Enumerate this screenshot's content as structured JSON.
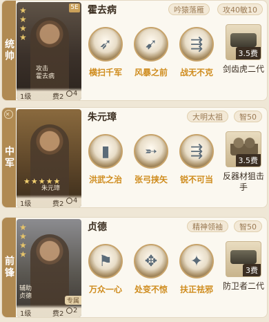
{
  "cards": [
    {
      "position": "统帅",
      "name": "霍去病",
      "tags": [
        "吟猿落雁",
        "攻40敏10"
      ],
      "portrait": {
        "role": "攻击",
        "name": "霍去病",
        "level": "1级",
        "cost": "费2",
        "range": "4",
        "stars": 4,
        "corner": "5E"
      },
      "skills": [
        {
          "icon": "arrow-volley-icon",
          "label": "横扫千军"
        },
        {
          "icon": "storm-arrows-icon",
          "label": "风暴之前"
        },
        {
          "icon": "spears-icon",
          "label": "战无不克"
        }
      ],
      "equipment": {
        "name": "剑齿虎二代",
        "cost": "3.5费",
        "type": "tank"
      }
    },
    {
      "position": "中军",
      "name": "朱元璋",
      "tags": [
        "大明太祖",
        "智50"
      ],
      "portrait": {
        "role": "",
        "name": "朱元璋",
        "level": "1级",
        "cost": "费2",
        "range": "4",
        "stars": 5
      },
      "skills": [
        {
          "icon": "pillar-icon",
          "label": "洪武之治"
        },
        {
          "icon": "archer-icon",
          "label": "张弓挟矢"
        },
        {
          "icon": "spears-icon",
          "label": "锐不可当"
        }
      ],
      "equipment": {
        "name": "反器材狙击手",
        "cost": "3.5费",
        "type": "troops"
      }
    },
    {
      "position": "前锋",
      "name": "贞德",
      "tags": [
        "精神领袖",
        "智50"
      ],
      "portrait": {
        "role": "辅助",
        "name": "贞德",
        "level": "1级",
        "cost": "费2",
        "range": "2",
        "stars": 4,
        "special": "专属"
      },
      "skills": [
        {
          "icon": "rally-icon",
          "label": "万众一心"
        },
        {
          "icon": "calm-icon",
          "label": "处变不惊"
        },
        {
          "icon": "purge-icon",
          "label": "扶正祛邪"
        }
      ],
      "equipment": {
        "name": "防卫者二代",
        "cost": "3费",
        "type": "tank"
      }
    }
  ]
}
